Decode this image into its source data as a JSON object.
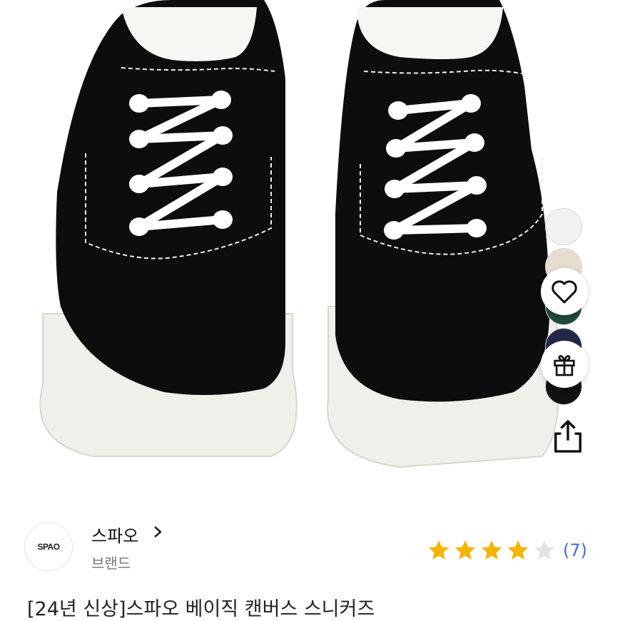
{
  "product": {
    "title": "[24년 신상]스파오 베이직 캔버스 스니커즈",
    "image_alt": "black canvas sneakers"
  },
  "brand": {
    "logo_text": "SPAO",
    "name": "스파오",
    "subtitle": "브랜드"
  },
  "rating": {
    "stars": 4,
    "max_stars": 5,
    "review_count": "(7)",
    "star_color": "#f5b400",
    "empty_star_color": "#e3e3e3",
    "count_color": "#3d6fd8"
  },
  "color_options": [
    {
      "name": "white",
      "color": "#f2f1ef"
    },
    {
      "name": "beige",
      "color": "#e6ddd0"
    },
    {
      "name": "green",
      "color": "#1f4a3a"
    },
    {
      "name": "navy",
      "color": "#23284a"
    },
    {
      "name": "black",
      "color": "#111111"
    }
  ],
  "actions": {
    "wishlist_icon": "heart-icon",
    "gift_icon": "gift-icon",
    "share_icon": "share-icon"
  }
}
